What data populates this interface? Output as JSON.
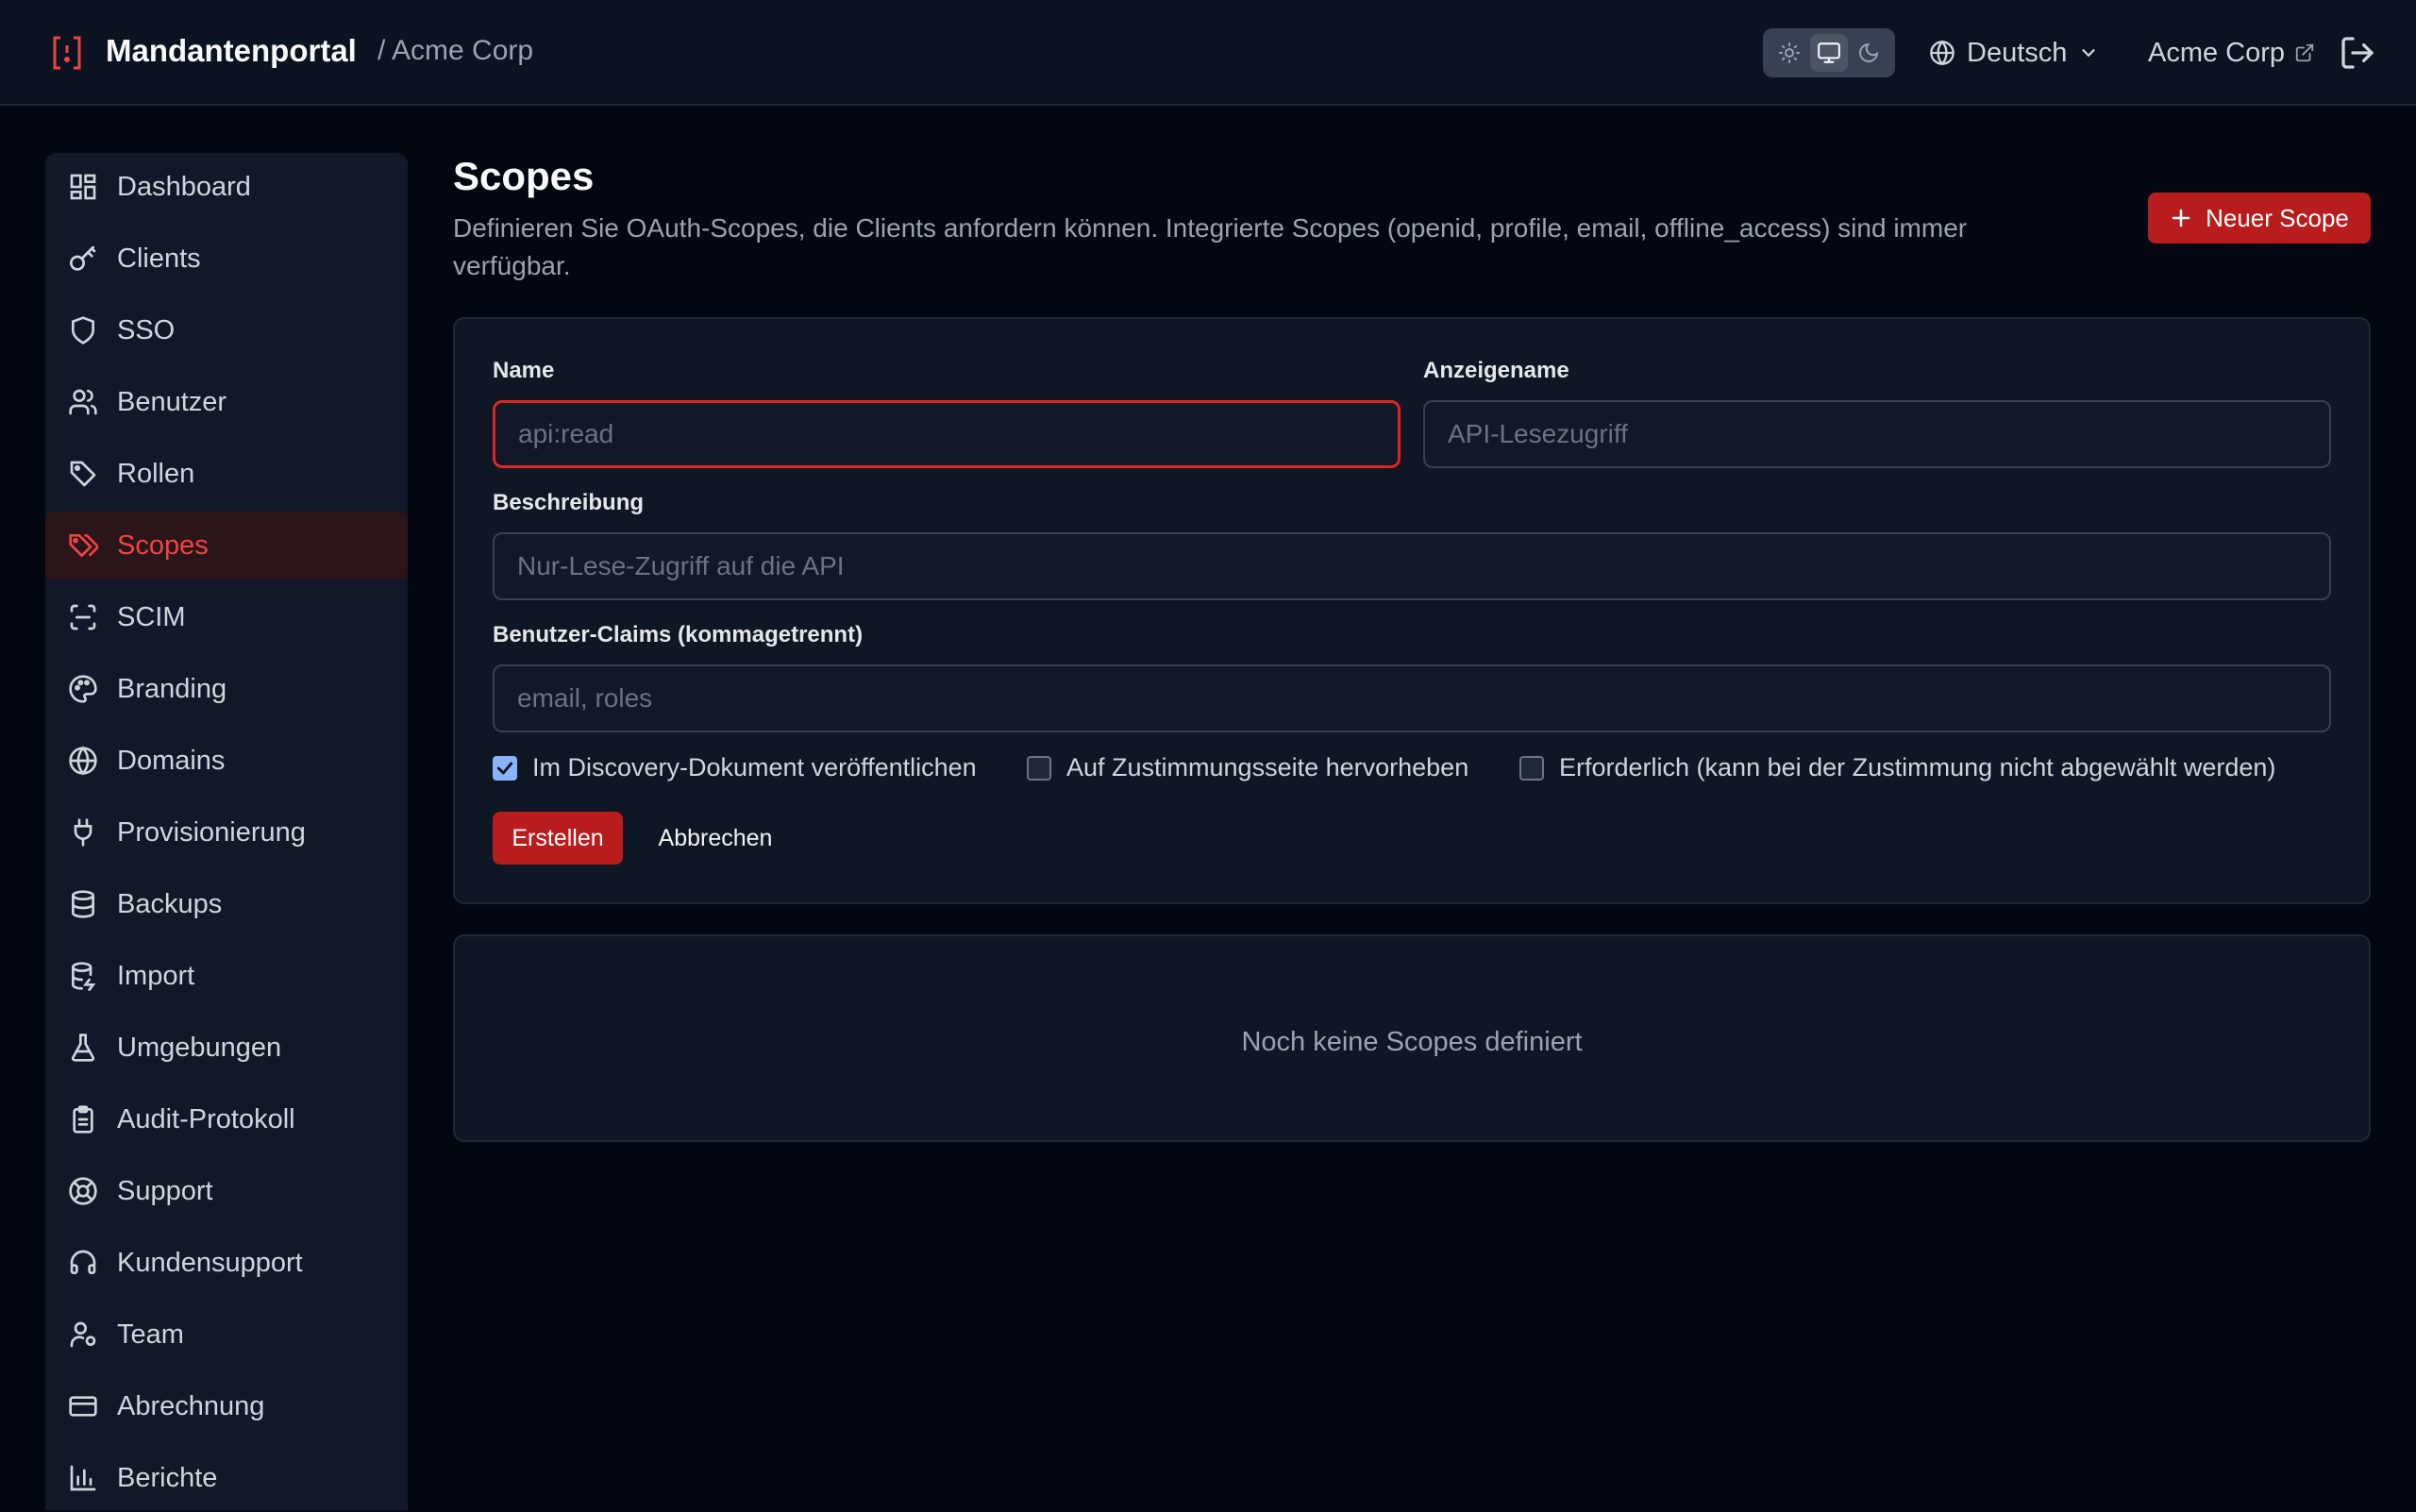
{
  "header": {
    "app_title": "Mandantenportal",
    "breadcrumb": "/ Acme Corp",
    "theme_options": [
      "light",
      "system",
      "dark"
    ],
    "theme_selected": "system",
    "language": "Deutsch",
    "account": "Acme Corp"
  },
  "sidebar": {
    "items": [
      {
        "label": "Dashboard",
        "icon": "dashboard-icon"
      },
      {
        "label": "Clients",
        "icon": "key-icon"
      },
      {
        "label": "SSO",
        "icon": "shield-icon"
      },
      {
        "label": "Benutzer",
        "icon": "users-icon"
      },
      {
        "label": "Rollen",
        "icon": "tag-icon"
      },
      {
        "label": "Scopes",
        "icon": "tags-icon",
        "active": true
      },
      {
        "label": "SCIM",
        "icon": "scan-icon"
      },
      {
        "label": "Branding",
        "icon": "palette-icon"
      },
      {
        "label": "Domains",
        "icon": "globe-icon"
      },
      {
        "label": "Provisionierung",
        "icon": "plug-icon"
      },
      {
        "label": "Backups",
        "icon": "database-icon"
      },
      {
        "label": "Import",
        "icon": "database-import-icon"
      },
      {
        "label": "Umgebungen",
        "icon": "flask-icon"
      },
      {
        "label": "Audit-Protokoll",
        "icon": "clipboard-icon"
      },
      {
        "label": "Support",
        "icon": "lifebuoy-icon"
      },
      {
        "label": "Kundensupport",
        "icon": "headset-icon"
      },
      {
        "label": "Team",
        "icon": "user-cog-icon"
      },
      {
        "label": "Abrechnung",
        "icon": "credit-card-icon"
      },
      {
        "label": "Berichte",
        "icon": "bar-chart-icon"
      }
    ]
  },
  "main": {
    "title": "Scopes",
    "description": "Definieren Sie OAuth-Scopes, die Clients anfordern können. Integrierte Scopes (openid, profile, email, offline_access) sind immer verfügbar.",
    "new_button": "Neuer Scope",
    "form": {
      "name_label": "Name",
      "name_placeholder": "api:read",
      "name_value": "",
      "display_label": "Anzeigename",
      "display_placeholder": "API-Lesezugriff",
      "display_value": "",
      "description_label": "Beschreibung",
      "description_placeholder": "Nur-Lese-Zugriff auf die API",
      "description_value": "",
      "claims_label": "Benutzer-Claims (kommagetrennt)",
      "claims_placeholder": "email, roles",
      "claims_value": "",
      "checkboxes": [
        {
          "label": "Im Discovery-Dokument veröffentlichen",
          "checked": true
        },
        {
          "label": "Auf Zustimmungsseite hervorheben",
          "checked": false
        },
        {
          "label": "Erforderlich (kann bei der Zustimmung nicht abgewählt werden)",
          "checked": false
        }
      ],
      "create_button": "Erstellen",
      "cancel_button": "Abbrechen"
    },
    "empty_state": "Noch keine Scopes definiert"
  },
  "colors": {
    "accent": "#b91c1c",
    "background": "#030712",
    "panel": "#111827",
    "active_nav_text": "#ef4444"
  }
}
